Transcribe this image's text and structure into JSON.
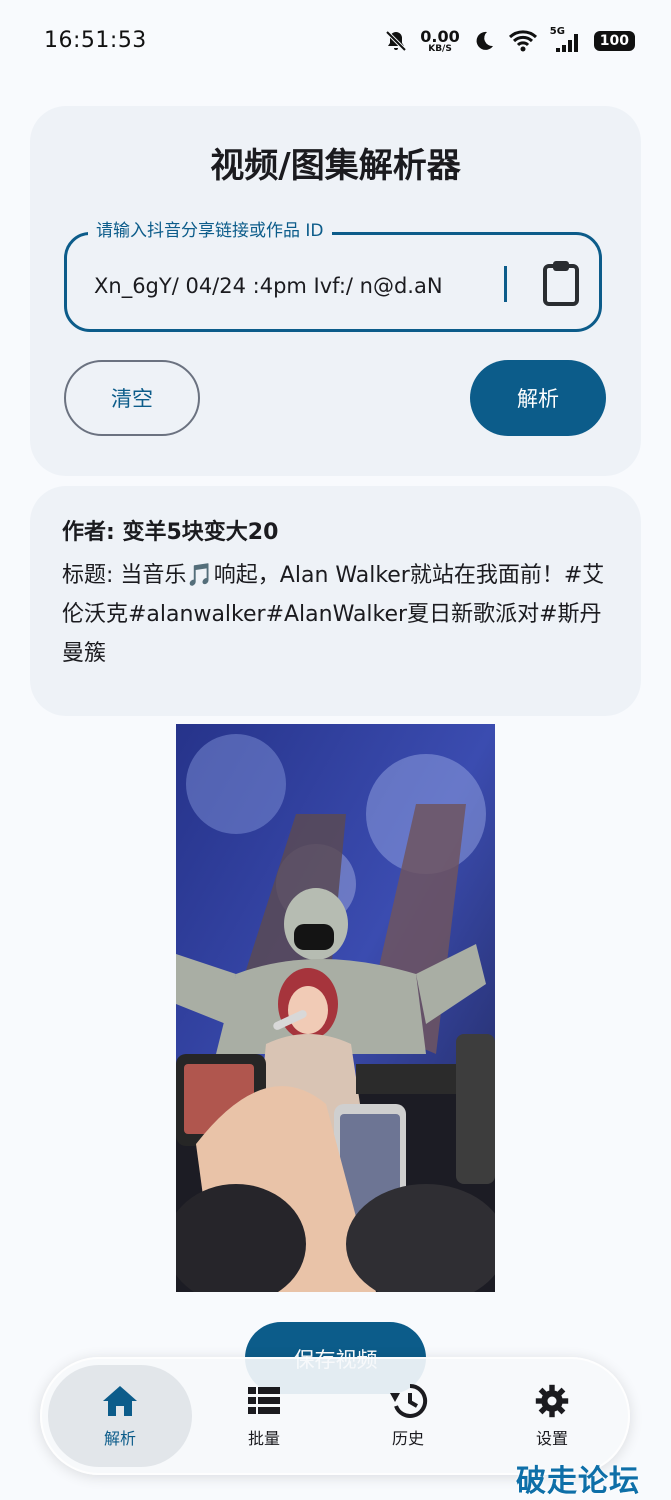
{
  "status_bar": {
    "time": "16:51:53",
    "net_speed_value": "0.00",
    "net_speed_unit": "KB/S",
    "signal_label": "5G",
    "battery": "100"
  },
  "app": {
    "title": "视频/图集解析器"
  },
  "input": {
    "label": "请输入抖音分享链接或作品 ID",
    "value": "Xn_6gY/ 04/24 :4pm Ivf:/ n@d.aN",
    "clipboard_icon": "clipboard-icon"
  },
  "actions": {
    "clear_label": "清空",
    "parse_label": "解析",
    "save_label": "保存视频"
  },
  "result": {
    "author_prefix": "作者: ",
    "author_name": "变羊5块变大20",
    "title_text": "标题: 当音乐🎵响起，Alan Walker就站在我面前！#艾伦沃克#alanwalker#AlanWalker夏日新歌派对#斯丹曼簇"
  },
  "nav": {
    "items": [
      {
        "label": "解析",
        "icon": "home-icon"
      },
      {
        "label": "批量",
        "icon": "list-icon"
      },
      {
        "label": "历史",
        "icon": "history-icon"
      },
      {
        "label": "设置",
        "icon": "gear-icon"
      }
    ]
  },
  "watermark": "破走论坛",
  "colors": {
    "accent": "#0c5c8a",
    "card_bg": "#eef2f7",
    "page_bg": "#f8fafd"
  }
}
